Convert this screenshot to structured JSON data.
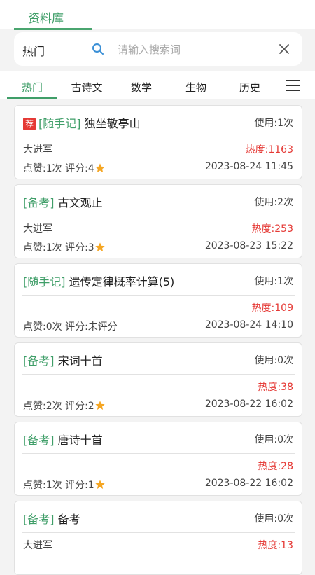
{
  "header": {
    "tab_label": "资料库"
  },
  "search": {
    "category": "热门",
    "placeholder": "请输入搜索词"
  },
  "categories": [
    {
      "label": "热门",
      "active": true
    },
    {
      "label": "古诗文",
      "active": false
    },
    {
      "label": "数学",
      "active": false
    },
    {
      "label": "生物",
      "active": false
    },
    {
      "label": "历史",
      "active": false
    }
  ],
  "colors": {
    "accent": "#3f9e68",
    "heat": "#e53935",
    "badge": "#e53935",
    "star": "#f5a623"
  },
  "icons": {
    "search": "search-icon",
    "clear": "close-icon",
    "menu": "menu-icon",
    "star": "star-icon"
  },
  "items": [
    {
      "badge": "荐",
      "tag": "[随手记]",
      "title": "独坐敬亭山",
      "usage": "使用:1次",
      "author": "大进军",
      "heat": "热度:1163",
      "likes": "点赞:1次",
      "rating_label": "评分:4",
      "has_star": true,
      "date": "2023-08-24 11:45"
    },
    {
      "badge": "",
      "tag": "[备考]",
      "title": "古文观止",
      "usage": "使用:2次",
      "author": "大进军",
      "heat": "热度:253",
      "likes": "点赞:1次",
      "rating_label": "评分:3",
      "has_star": true,
      "date": "2023-08-23 15:22"
    },
    {
      "badge": "",
      "tag": "[随手记]",
      "title": "遗传定律概率计算(5)",
      "usage": "使用:1次",
      "author": "",
      "heat": "热度:109",
      "likes": "点赞:0次",
      "rating_label": "评分:未评分",
      "has_star": false,
      "date": "2023-08-24 14:10"
    },
    {
      "badge": "",
      "tag": "[备考]",
      "title": "宋词十首",
      "usage": "使用:0次",
      "author": "",
      "heat": "热度:38",
      "likes": "点赞:2次",
      "rating_label": "评分:2",
      "has_star": true,
      "date": "2023-08-22 16:02"
    },
    {
      "badge": "",
      "tag": "[备考]",
      "title": "唐诗十首",
      "usage": "使用:0次",
      "author": "",
      "heat": "热度:28",
      "likes": "点赞:1次",
      "rating_label": "评分:1",
      "has_star": true,
      "date": "2023-08-22 16:02"
    },
    {
      "badge": "",
      "tag": "[备考]",
      "title": "备考",
      "usage": "使用:0次",
      "author": "大进军",
      "heat": "热度:13",
      "likes": "",
      "rating_label": "",
      "has_star": false,
      "date": ""
    }
  ]
}
